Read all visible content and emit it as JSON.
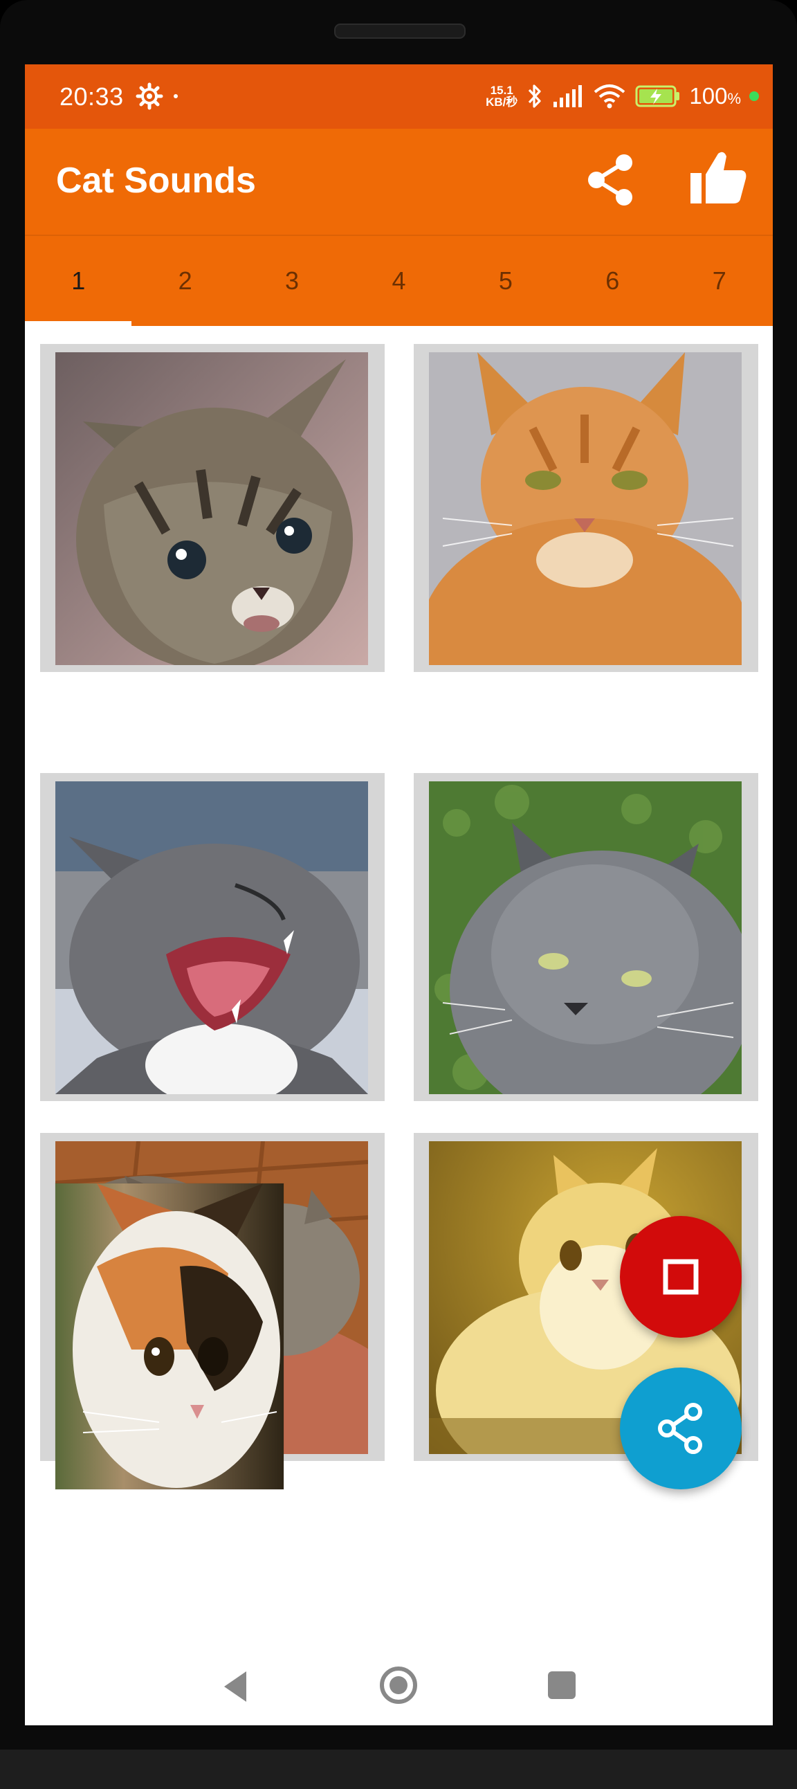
{
  "status_bar": {
    "time": "20:33",
    "net_speed_value": "15.1",
    "net_speed_unit": "KB/秒",
    "battery_percent": "100",
    "battery_symbol": "%"
  },
  "app_bar": {
    "title": "Cat Sounds"
  },
  "tabs": [
    {
      "label": "1",
      "active": true
    },
    {
      "label": "2"
    },
    {
      "label": "3"
    },
    {
      "label": "4"
    },
    {
      "label": "5"
    },
    {
      "label": "6"
    },
    {
      "label": "7"
    }
  ],
  "tiles": [
    {
      "name": "kitten-tabby"
    },
    {
      "name": "orange-tabby-cat"
    },
    {
      "name": "hissing-gray-cat"
    },
    {
      "name": "gray-fluffy-cat"
    },
    {
      "name": "two-kittens-playing"
    },
    {
      "name": "golden-fluffy-cat"
    }
  ],
  "colors": {
    "status_bar": "#e4560b",
    "app_bar": "#ef6a06",
    "fab_stop": "#d20b0b",
    "fab_share": "#0f9fd0",
    "tile_border": "#d6d6d6"
  }
}
